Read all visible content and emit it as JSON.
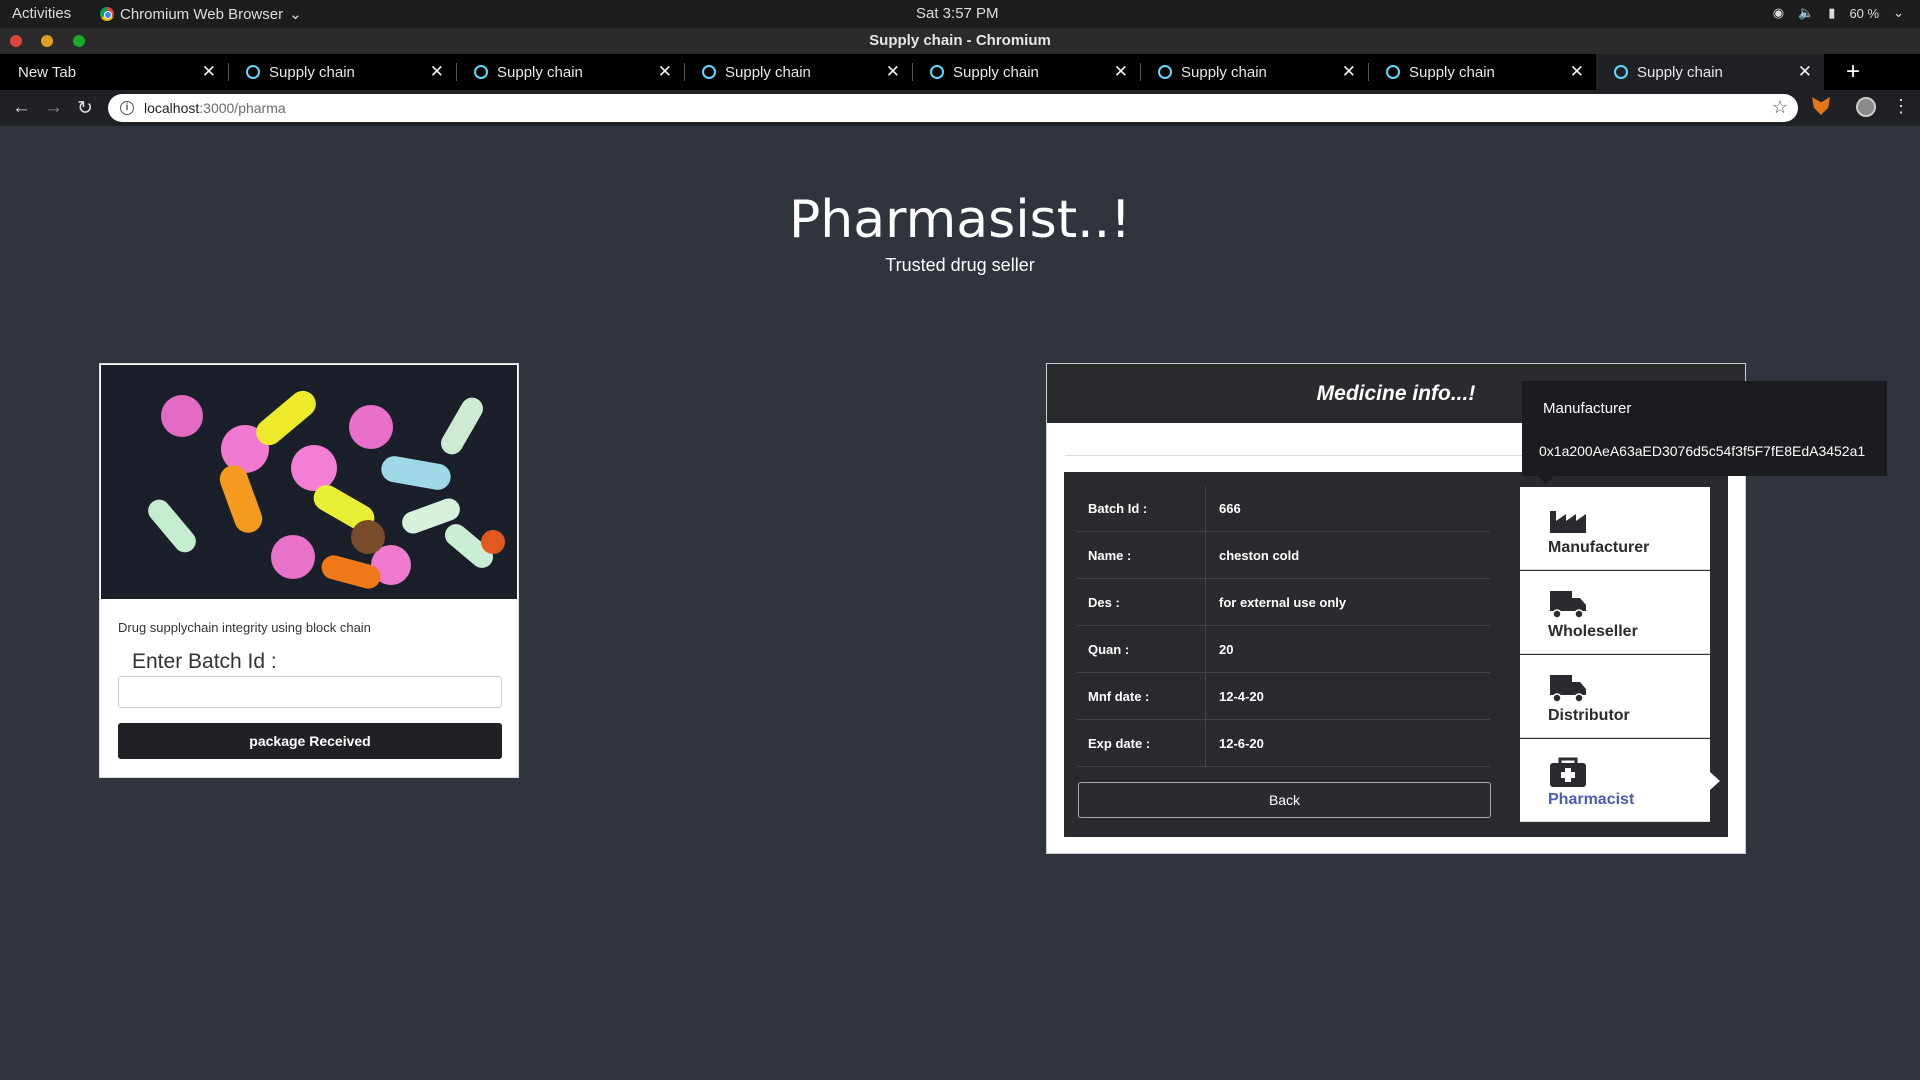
{
  "os": {
    "activities": "Activities",
    "app_name": "Chromium Web Browser",
    "clock": "Sat  3:57 PM",
    "battery": "60 %"
  },
  "window": {
    "title": "Supply chain - Chromium"
  },
  "tabs": [
    {
      "label": "New Tab"
    },
    {
      "label": "Supply chain"
    },
    {
      "label": "Supply chain"
    },
    {
      "label": "Supply chain"
    },
    {
      "label": "Supply chain"
    },
    {
      "label": "Supply chain"
    },
    {
      "label": "Supply chain"
    },
    {
      "label": "Supply chain"
    }
  ],
  "address": {
    "host": "localhost",
    "path": ":3000/pharma"
  },
  "page": {
    "title": "Pharmasist..!",
    "subtitle": "Trusted drug seller"
  },
  "left_card": {
    "caption": "Drug supplychain integrity using block chain",
    "batch_label": "Enter Batch Id :",
    "batch_value": "",
    "button": "package Received"
  },
  "medicine": {
    "header": "Medicine info...!",
    "rows": [
      {
        "key": "Batch Id :",
        "value": "666"
      },
      {
        "key": "Name :",
        "value": "cheston cold"
      },
      {
        "key": "Des :",
        "value": "for external use only"
      },
      {
        "key": "Quan :",
        "value": "20"
      },
      {
        "key": "Mnf date :",
        "value": "12-4-20"
      },
      {
        "key": "Exp date :",
        "value": "12-6-20"
      }
    ],
    "back": "Back"
  },
  "steps": [
    {
      "label": "Manufacturer",
      "icon": "factory-icon"
    },
    {
      "label": "Wholeseller",
      "icon": "truck-icon"
    },
    {
      "label": "Distributor",
      "icon": "truck-icon"
    },
    {
      "label": "Pharmacist",
      "icon": "medkit-icon",
      "active": true
    }
  ],
  "tooltip": {
    "title": "Manufacturer",
    "address": "0x1a200AeA63aED3076d5c54f3f5F7fE8EdA3452a1"
  },
  "colors": {
    "page_bg": "#30343d",
    "active_step": "#4a5bb8"
  }
}
